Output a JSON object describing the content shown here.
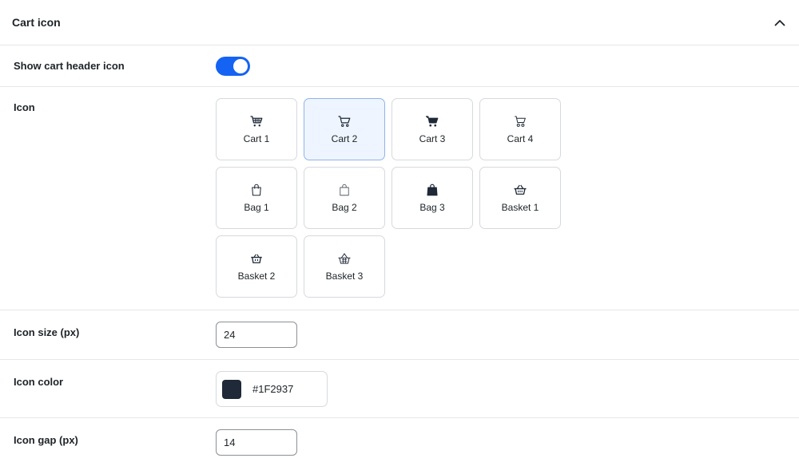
{
  "panel": {
    "title": "Cart icon"
  },
  "show_icon": {
    "label": "Show cart header icon",
    "enabled": true
  },
  "icon": {
    "label": "Icon",
    "selected": "Cart 2",
    "options": [
      {
        "label": "Cart 1",
        "icon": "cart-1-icon"
      },
      {
        "label": "Cart 2",
        "icon": "cart-2-icon"
      },
      {
        "label": "Cart 3",
        "icon": "cart-3-icon"
      },
      {
        "label": "Cart 4",
        "icon": "cart-4-icon"
      },
      {
        "label": "Bag 1",
        "icon": "bag-1-icon"
      },
      {
        "label": "Bag 2",
        "icon": "bag-2-icon"
      },
      {
        "label": "Bag 3",
        "icon": "bag-3-icon"
      },
      {
        "label": "Basket 1",
        "icon": "basket-1-icon"
      },
      {
        "label": "Basket 2",
        "icon": "basket-2-icon"
      },
      {
        "label": "Basket 3",
        "icon": "basket-3-icon"
      }
    ]
  },
  "icon_size": {
    "label": "Icon size (px)",
    "value": "24"
  },
  "icon_color": {
    "label": "Icon color",
    "value": "#1F2937"
  },
  "icon_gap": {
    "label": "Icon gap (px)",
    "value": "14"
  },
  "colors": {
    "accent": "#1463F3",
    "selected_bg": "#EEF5FE",
    "icon": "#1F2937"
  }
}
